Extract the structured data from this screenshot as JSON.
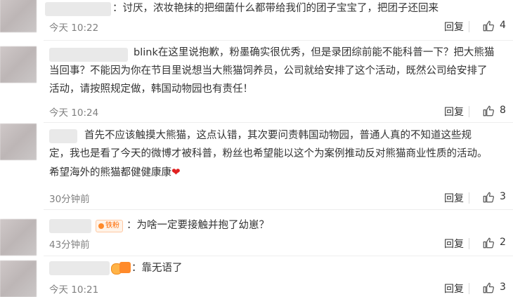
{
  "comments": [
    {
      "text": "：讨厌，浓妆艳抹的把细菌什么都带给我们的团子宝宝了，把团子还回来",
      "time": "今天 10:22",
      "reply": "回复",
      "likes": "4"
    },
    {
      "text_line1": "blink在这里说抱歉，粉墨确实很优秀，但是录团综前能不能科普一下？把大熊猫",
      "text_line2": "当回事？不能因为你在节目里说想当大熊猫饲养员，公司就给安排了这个活动，既然公司给安排了",
      "text_line3": "活动，请按照规定做，韩国动物园也有责任！",
      "time": "今天 10:24",
      "reply": "回复",
      "likes": "8"
    },
    {
      "text_line1": "首先不应该触摸大熊猫，这点认错，其次要问责韩国动物园，普通人真的不知道这些规",
      "text_line2": "定，我也是看了今天的微博才被科普，粉丝也希望能以这个为案例推动反对熊猫商业性质的活动。",
      "text_line3": "希望海外的熊猫都健健康康",
      "heart": "❤",
      "time": "30分钟前",
      "reply": "回复",
      "likes": "3"
    },
    {
      "badge": "铁粉",
      "text": "：为啥一定要接触并抱了幼崽？",
      "time": "43分钟前",
      "reply": "回复",
      "likes": "2"
    },
    {
      "text": "：靠无语了",
      "time": "今天 10:21",
      "reply": "回复",
      "likes": "3"
    }
  ],
  "icons": {
    "like": "thumbs-up-icon"
  },
  "colors": {
    "meta": "#808080",
    "text": "#333333",
    "heart": "#e02020",
    "badge": "#ff6a00"
  }
}
